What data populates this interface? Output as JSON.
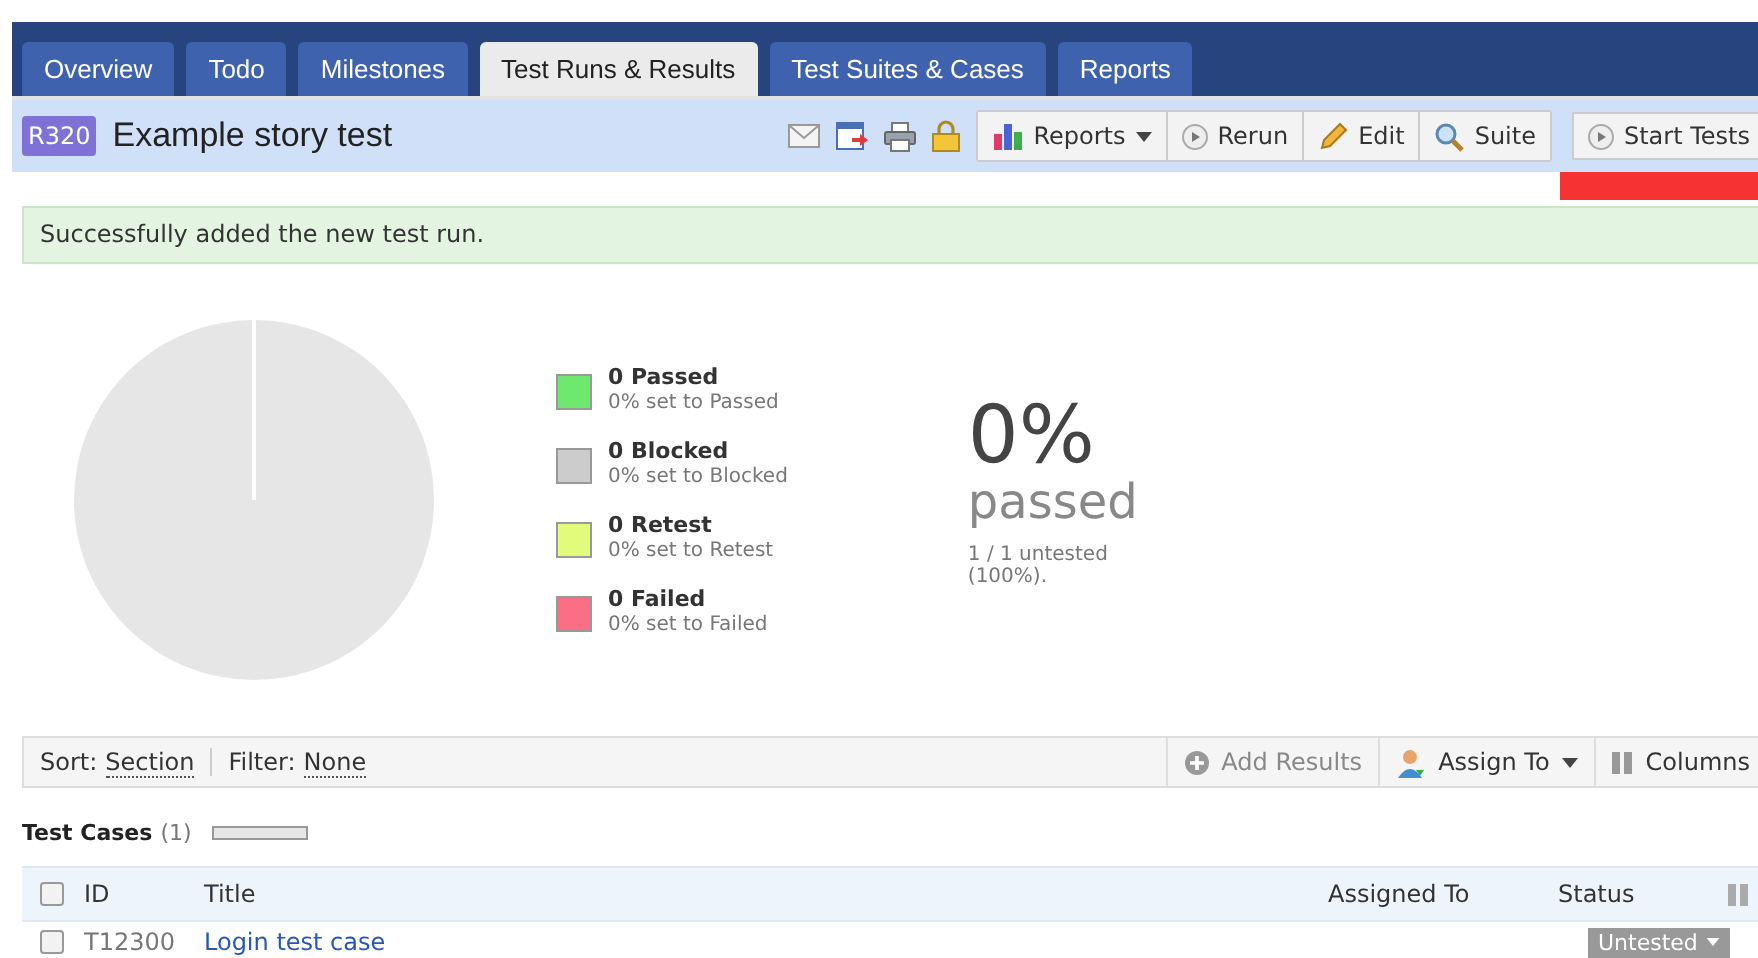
{
  "tabs": [
    {
      "label": "Overview",
      "selected": false
    },
    {
      "label": "Todo",
      "selected": false
    },
    {
      "label": "Milestones",
      "selected": false
    },
    {
      "label": "Test Runs & Results",
      "selected": true
    },
    {
      "label": "Test Suites & Cases",
      "selected": false
    },
    {
      "label": "Reports",
      "selected": false
    }
  ],
  "run": {
    "id": "R320",
    "title": "Example story test"
  },
  "toolbar": {
    "icons": [
      {
        "kind": "mail"
      },
      {
        "kind": "export"
      },
      {
        "kind": "print"
      },
      {
        "kind": "lock"
      }
    ],
    "buttons": [
      {
        "label": "Reports",
        "kind": "chart",
        "dropdown": true
      },
      {
        "label": "Rerun",
        "kind": "play",
        "dropdown": false
      },
      {
        "label": "Edit",
        "kind": "pencil",
        "dropdown": false
      },
      {
        "label": "Suite",
        "kind": "search",
        "dropdown": false
      }
    ],
    "start_button": {
      "label": "Start Tests"
    }
  },
  "message": "Successfully added the new test run.",
  "legend": [
    {
      "label": "0 Passed",
      "detail": "0% set to Passed",
      "color": "#6ee86e"
    },
    {
      "label": "0 Blocked",
      "detail": "0% set to Blocked",
      "color": "#cccccc"
    },
    {
      "label": "0 Retest",
      "detail": "0% set to Retest",
      "color": "#e2fb7c"
    },
    {
      "label": "0 Failed",
      "detail": "0% set to Failed",
      "color": "#fb6f86"
    }
  ],
  "summary": {
    "percent": "0%",
    "label": "passed",
    "detail": "1 / 1 untested (100%)."
  },
  "sort_bar": {
    "sort_label": "Sort:",
    "sort_value": "Section",
    "filter_label": "Filter:",
    "filter_value": "None",
    "actions": [
      {
        "label": "Add Results",
        "kind": "plus",
        "disabled": true,
        "dropdown": false
      },
      {
        "label": "Assign To",
        "kind": "person",
        "disabled": false,
        "dropdown": true
      },
      {
        "label": "Columns",
        "kind": "columns",
        "disabled": false,
        "dropdown": false
      }
    ]
  },
  "test_cases": {
    "title": "Test Cases",
    "count": "(1)",
    "level": 0
  },
  "table": {
    "columns": [
      "ID",
      "Title",
      "Assigned To",
      "Status"
    ],
    "all_checked": false,
    "rows": [
      {
        "checked": false,
        "id": "T12300",
        "title": "Login test case",
        "status": "Untested"
      }
    ]
  }
}
